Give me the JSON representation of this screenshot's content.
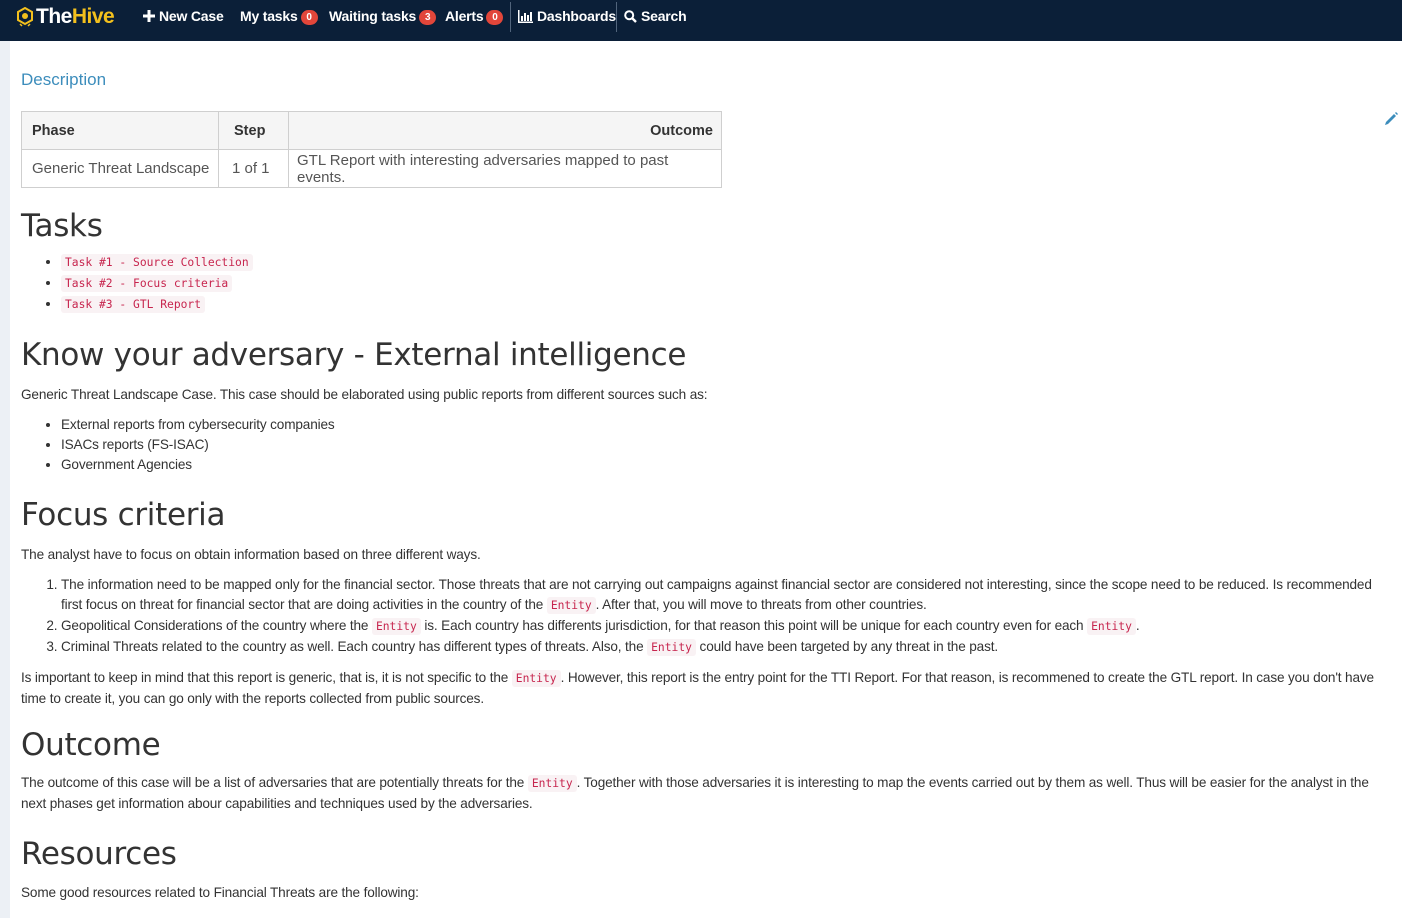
{
  "navbar": {
    "brand_the": "The",
    "brand_hive": "Hive",
    "new_case": "New Case",
    "my_tasks": "My tasks",
    "my_tasks_count": "0",
    "waiting_tasks": "Waiting tasks",
    "waiting_tasks_count": "3",
    "alerts": "Alerts",
    "alerts_count": "0",
    "dashboards": "Dashboards",
    "search": "Search"
  },
  "description": {
    "title": "Description",
    "table": {
      "headers": [
        "Phase",
        "Step",
        "Outcome"
      ],
      "row": [
        "Generic Threat Landscape",
        "1 of 1",
        "GTL Report with interesting adversaries mapped to past events."
      ]
    }
  },
  "tasks": {
    "heading": "Tasks",
    "items": [
      "Task #1 - Source Collection",
      "Task #2 - Focus criteria",
      "Task #3 - GTL Report"
    ]
  },
  "adversary": {
    "heading": "Know your adversary - External intelligence",
    "intro": "Generic Threat Landscape Case. This case should be elaborated using public reports from different sources such as:",
    "items": [
      "External reports from cybersecurity companies",
      "ISACs reports (FS-ISAC)",
      "Government Agencies"
    ]
  },
  "focus": {
    "heading": "Focus criteria",
    "intro": "The analyst have to focus on obtain information based on three different ways.",
    "entity": "Entity",
    "item1_a": "The information need to be mapped only for the financial sector. Those threats that are not carrying out campaigns against financial sector are considered not interesting, since the scope need to be reduced. Is recommended first focus on threat for financial sector that are doing activities in the country of the ",
    "item1_b": ". After that, you will move to threats from other countries.",
    "item2_a": "Geopolitical Considerations of the country where the ",
    "item2_b": " is. Each country has differents jurisdiction, for that reason this point will be unique for each country even for each ",
    "item2_c": ".",
    "item3_a": "Criminal Threats related to the country as well. Each country has different types of threats. Also, the ",
    "item3_b": " could have been targeted by any threat in the past.",
    "note_a": "Is important to keep in mind that this report is generic, that is, it is not specific to the ",
    "note_b": ". However, this report is the entry point for the TTI Report. For that reason, is recommened to create the GTL report. In case you don't have time to create it, you can go only with the reports collected from public sources."
  },
  "outcome": {
    "heading": "Outcome",
    "text_a": "The outcome of this case will be a list of adversaries that are potentially threats for the ",
    "text_b": ". Together with those adversaries it is interesting to map the events carried out by them as well. Thus will be easier for the analyst in the next phases get information abour capabilities and techniques used by the adversaries."
  },
  "resources": {
    "heading": "Resources",
    "text": "Some good resources related to Financial Threats are the following:"
  },
  "colors": {
    "navbar_bg": "#0b1f38",
    "brand_accent": "#f3c01d",
    "badge": "#e2463a",
    "link": "#3c8dbc",
    "code_fg": "#c7254e",
    "code_bg": "#f9f2f4"
  }
}
